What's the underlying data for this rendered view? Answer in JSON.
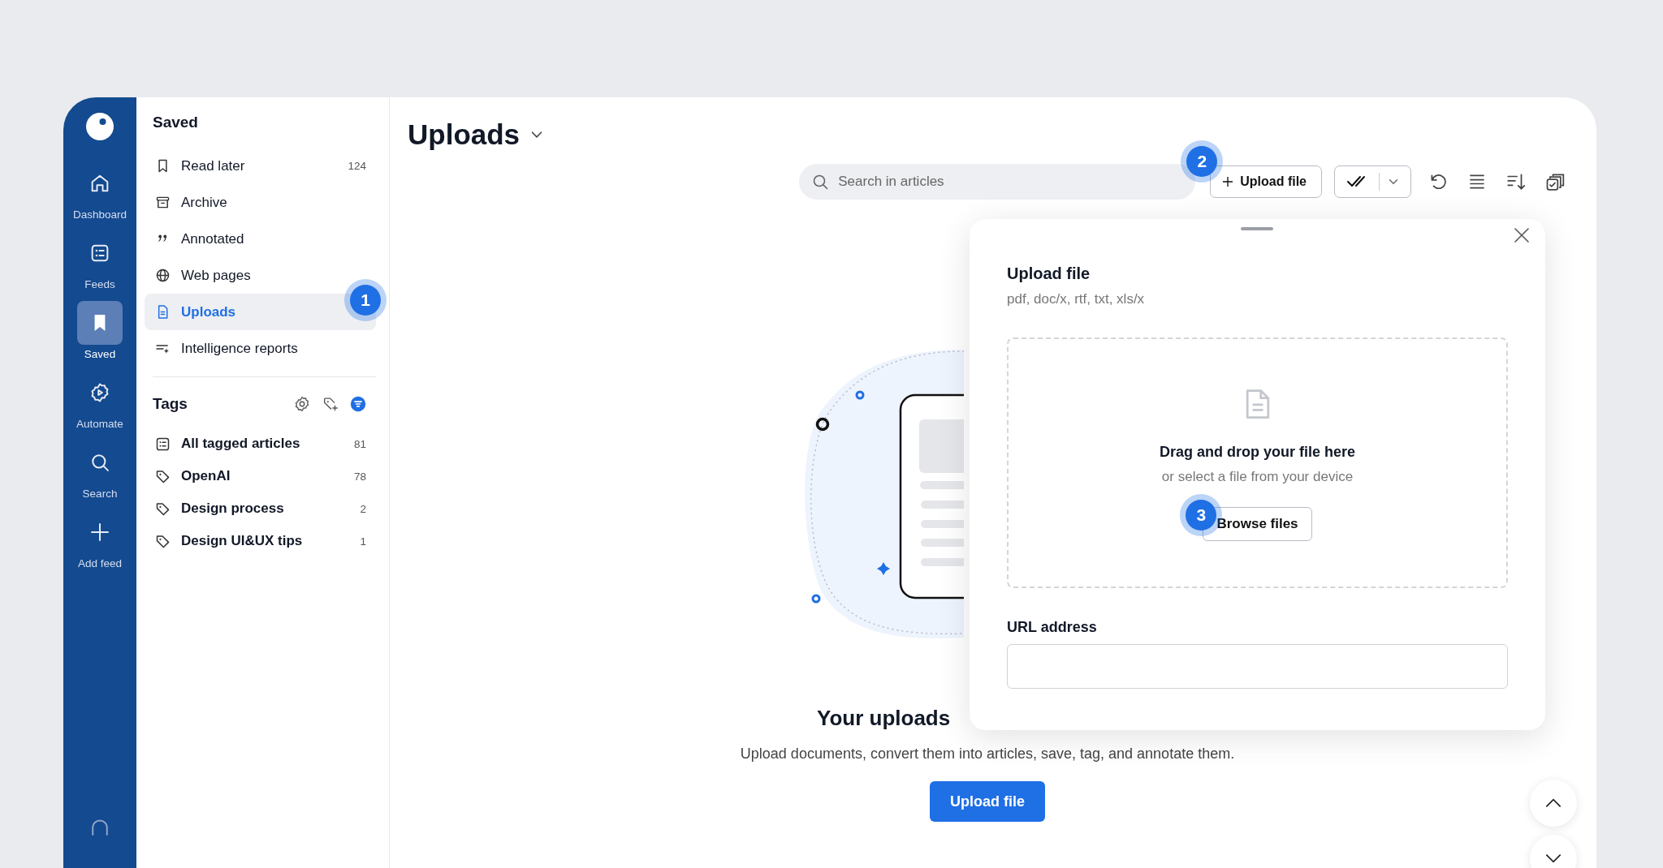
{
  "rail": {
    "items": [
      {
        "label": "Dashboard",
        "selected": false
      },
      {
        "label": "Feeds",
        "selected": false
      },
      {
        "label": "Saved",
        "selected": true
      },
      {
        "label": "Automate",
        "selected": false
      },
      {
        "label": "Search",
        "selected": false
      },
      {
        "label": "Add feed",
        "selected": false
      }
    ]
  },
  "sidebar": {
    "title": "Saved",
    "items": [
      {
        "label": "Read later",
        "count": "124",
        "selected": false
      },
      {
        "label": "Archive",
        "selected": false
      },
      {
        "label": "Annotated",
        "selected": false
      },
      {
        "label": "Web pages",
        "selected": false
      },
      {
        "label": "Uploads",
        "selected": true,
        "callout": "1"
      },
      {
        "label": "Intelligence reports",
        "selected": false
      }
    ],
    "tags": {
      "title": "Tags",
      "items": [
        {
          "label": "All tagged articles",
          "count": "81"
        },
        {
          "label": "OpenAI",
          "count": "78"
        },
        {
          "label": "Design process",
          "count": "2"
        },
        {
          "label": "Design UI&UX tips",
          "count": "1"
        }
      ]
    }
  },
  "main": {
    "title": "Uploads",
    "search": {
      "placeholder": "Search in articles"
    },
    "upload_button": {
      "label": "Upload file",
      "callout": "2"
    },
    "empty_state": {
      "heading": "Your uploads",
      "description": "Upload documents, convert them into articles, save, tag, and annotate them.",
      "button": "Upload file"
    }
  },
  "upload_panel": {
    "title": "Upload file",
    "formats": "pdf, doc/x, rtf, txt, xls/x",
    "dropzone": {
      "heading": "Drag and drop your file here",
      "hint": "or select a file from your device",
      "button": {
        "label": "Browse files",
        "callout": "3"
      }
    },
    "url_field": {
      "label": "URL address"
    }
  }
}
